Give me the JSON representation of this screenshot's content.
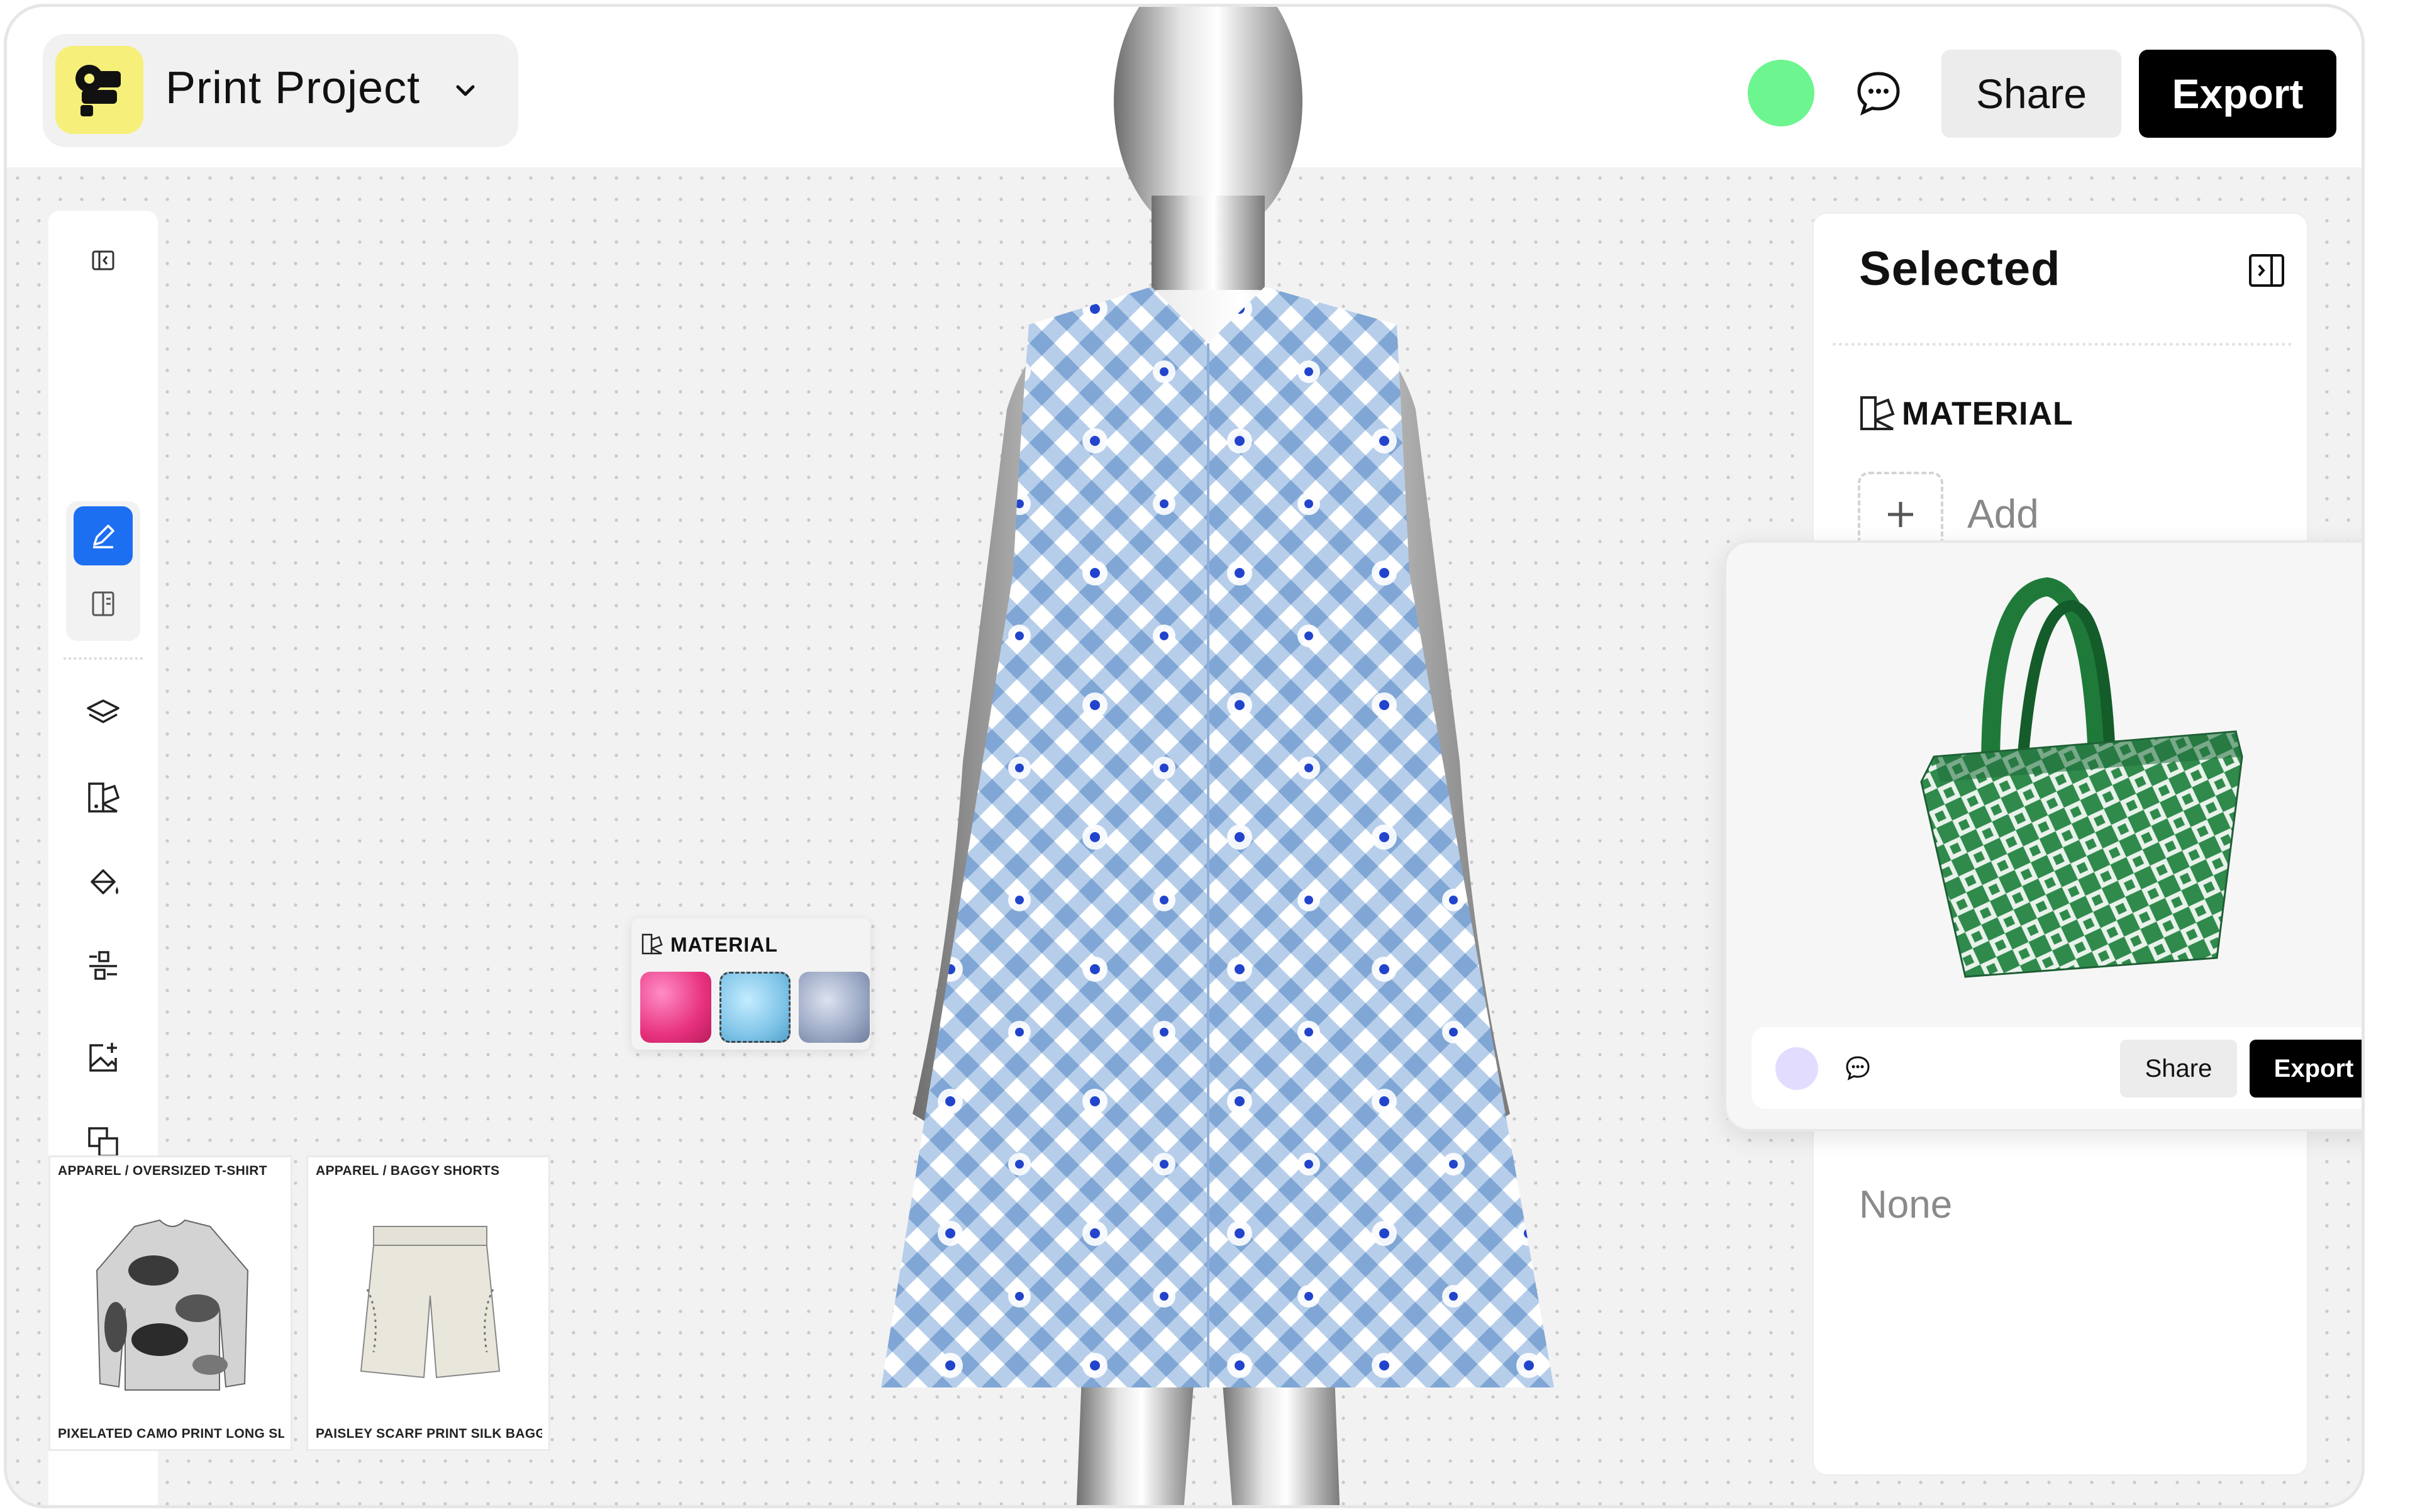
{
  "app": {
    "project_title": "Print Project",
    "share_label": "Share",
    "export_label": "Export",
    "status_color": "#6df58f",
    "accent": "#1d6ff2"
  },
  "toolbar": {
    "tools": [
      "collapse-sidebar-icon",
      "edit-pencil-icon",
      "document-icon",
      "layers-icon",
      "material-swatch-icon",
      "paint-bucket-icon",
      "adjust-sliders-icon",
      "add-image-icon",
      "duplicate-icon",
      "text-box-icon",
      "upload-icon"
    ]
  },
  "material_popup": {
    "label": "MATERIAL",
    "swatches": [
      "pink-satin",
      "sky-blue-tulle",
      "silver-chiffon"
    ]
  },
  "cards": [
    {
      "category": "APPAREL / OVERSIZED T-SHIRT",
      "name": "PIXELATED CAMO PRINT LONG SLEEVE..."
    },
    {
      "category": "APPAREL / BAGGY SHORTS",
      "name": "PAISLEY SCARF PRINT SILK BAGGY WID..."
    }
  ],
  "panel": {
    "title": "Selected",
    "material_label": "MATERIAL",
    "add_label": "Add",
    "none_label": "None"
  },
  "preview": {
    "share_label": "Share",
    "export_label": "Export",
    "status_color": "#e2dcff"
  }
}
